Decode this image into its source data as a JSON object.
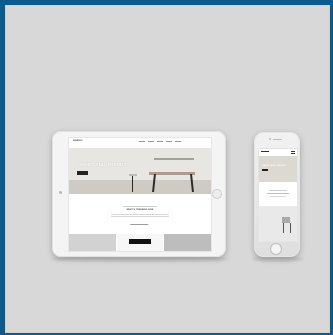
{
  "tablet": {
    "site_logo": "NORDIC",
    "hero_title": "SMART AND TRENDY",
    "section_title": "WHAT'S TRENDING NOW"
  },
  "phone": {
    "hero_title": "SMART AND TRENDY"
  },
  "colors": {
    "outer_border": "#0d5a8c",
    "background": "#d8d8d8",
    "device": "#f4f4f4"
  }
}
